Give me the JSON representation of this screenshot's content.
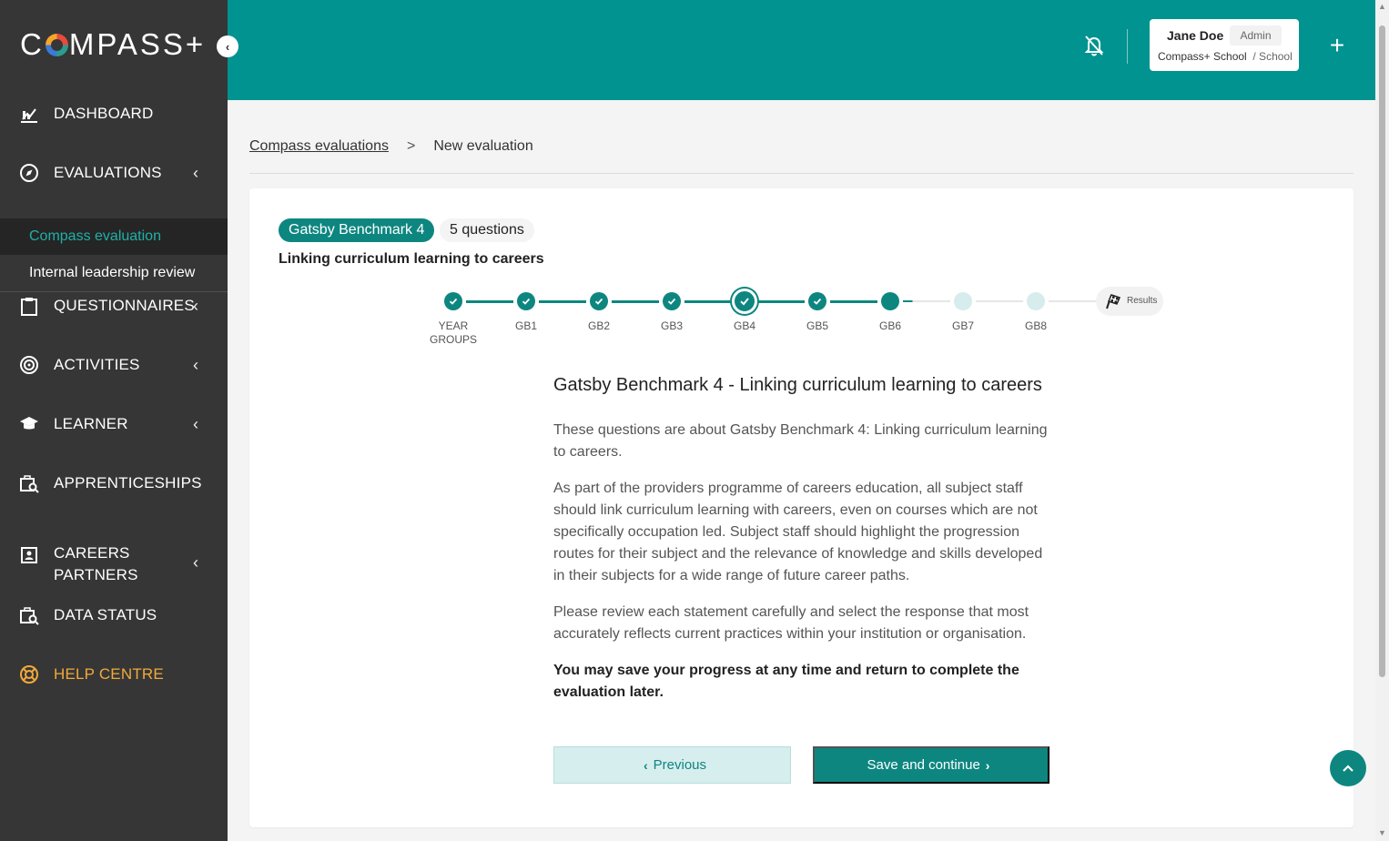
{
  "app": {
    "logo_text_pre": "C",
    "logo_text_post": "MPASS+",
    "collapse_icon": "chevron-left-icon"
  },
  "sidebar": {
    "items": [
      {
        "label": "DASHBOARD",
        "icon": "chart-icon"
      },
      {
        "label": "EVALUATIONS",
        "icon": "compass-icon"
      },
      {
        "label": "QUESTIONNAIRES",
        "icon": "clipboard-icon"
      },
      {
        "label": "ACTIVITIES",
        "icon": "target-icon"
      },
      {
        "label": "LEARNER",
        "icon": "graduation-cap-icon"
      },
      {
        "label": "APPRENTICESHIPS",
        "icon": "briefcase-search-icon"
      },
      {
        "label": "CAREERS PARTNERS",
        "label_line1": "CAREERS",
        "label_line2": "PARTNERS",
        "icon": "contact-card-icon"
      },
      {
        "label": "DATA STATUS",
        "icon": "briefcase-search-icon"
      },
      {
        "label": "HELP CENTRE",
        "icon": "lifebuoy-icon"
      }
    ],
    "sub_items": [
      {
        "label": "Compass evaluation",
        "active": true
      },
      {
        "label": "Internal leadership review",
        "active": false
      }
    ]
  },
  "header": {
    "user_name": "Jane Doe",
    "user_role": "Admin",
    "org_name": "Compass+ School",
    "org_type": "/ School",
    "add_label": "+"
  },
  "breadcrumb": {
    "parent": "Compass evaluations",
    "separator": ">",
    "current": "New evaluation"
  },
  "evaluation": {
    "benchmark_pill": "Gatsby Benchmark 4",
    "question_count": "5 questions",
    "subtitle": "Linking curriculum learning to careers",
    "steps": [
      {
        "label_line1": "YEAR",
        "label_line2": "GROUPS",
        "state": "done"
      },
      {
        "label_line1": "GB1",
        "label_line2": "",
        "state": "done"
      },
      {
        "label_line1": "GB2",
        "label_line2": "",
        "state": "done"
      },
      {
        "label_line1": "GB3",
        "label_line2": "",
        "state": "done"
      },
      {
        "label_line1": "GB4",
        "label_line2": "",
        "state": "current"
      },
      {
        "label_line1": "GB5",
        "label_line2": "",
        "state": "done"
      },
      {
        "label_line1": "GB6",
        "label_line2": "",
        "state": "active"
      },
      {
        "label_line1": "GB7",
        "label_line2": "",
        "state": "todo"
      },
      {
        "label_line1": "GB8",
        "label_line2": "",
        "state": "todo"
      }
    ],
    "results_label": "Results",
    "heading": "Gatsby Benchmark 4 - Linking curriculum learning to careers",
    "para1": "These questions are about Gatsby Benchmark 4: Linking curriculum learning to careers.",
    "para2": "As part of the providers programme of careers education, all subject staff should link curriculum learning with careers, even on courses which are not specifically occupation led. Subject staff should highlight the progression routes for their subject and the relevance of knowledge and skills developed in their subjects for a wide range of future career paths.",
    "para3": "Please review each statement carefully and select the response that most accurately reflects current practices within your institution or organisation.",
    "para4": "You may save your progress at any time and return to complete the evaluation later.",
    "prev_label": "Previous",
    "next_label": "Save and continue"
  },
  "colors": {
    "brand_teal": "#009390",
    "accent_teal": "#0e8680",
    "sidebar_bg": "#363636",
    "help_orange": "#f2a93b"
  }
}
